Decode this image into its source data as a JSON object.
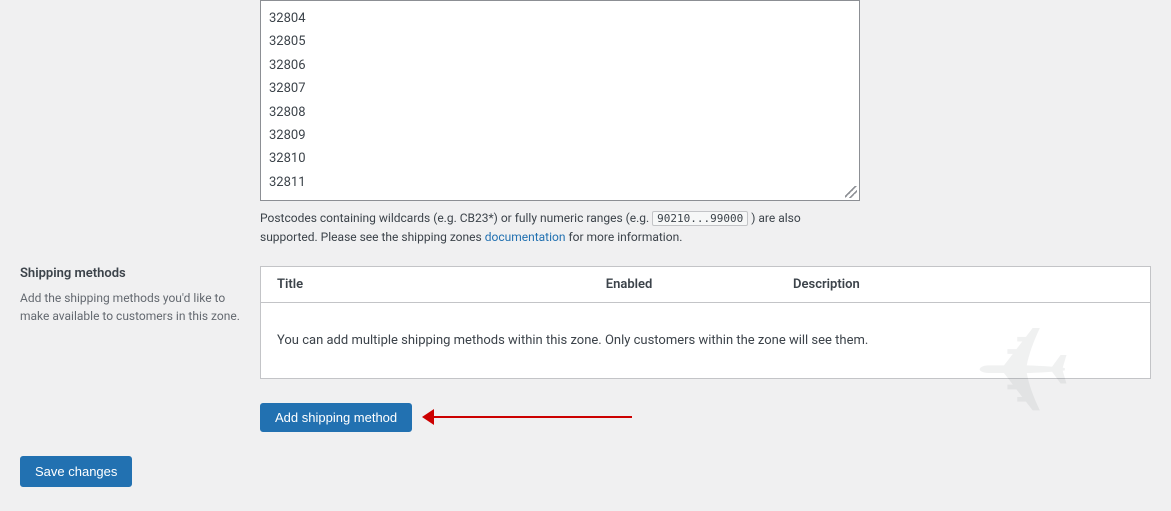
{
  "postcodes": {
    "lines": [
      "32804",
      "32805",
      "32806",
      "32807",
      "32808",
      "32809",
      "32810",
      "32811"
    ]
  },
  "hint": {
    "text_before": "Postcodes containing wildcards (e.g. CB23*) or fully numeric ranges (e.g. ",
    "code": "90210...99000",
    "text_after": " ) are also supported. Please see the shipping zones ",
    "link_text": "documentation",
    "text_end": " for more information."
  },
  "shipping_methods_section": {
    "label": "Shipping methods",
    "description": "Add the shipping methods you'd like to make available to customers in this zone."
  },
  "table": {
    "columns": [
      "Title",
      "Enabled",
      "Description"
    ],
    "empty_message": "You can add multiple shipping methods within this zone. Only customers within the zone will see them."
  },
  "buttons": {
    "add_shipping_method": "Add shipping method",
    "save_changes": "Save changes"
  }
}
